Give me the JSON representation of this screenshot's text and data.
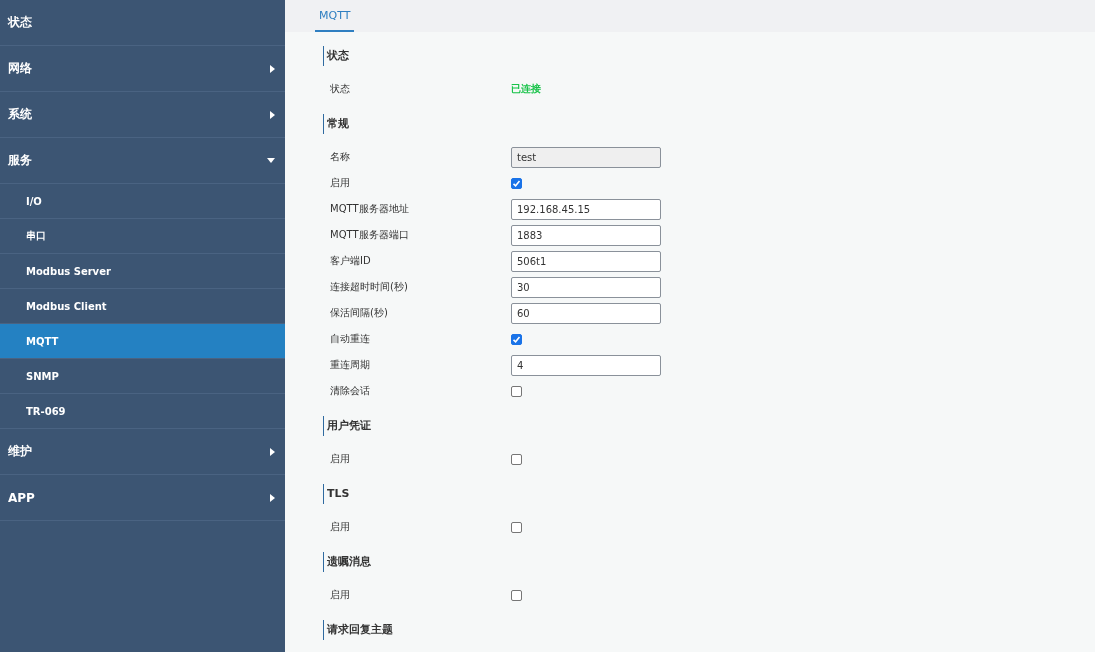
{
  "sidebar": {
    "items": [
      {
        "label": "状态"
      },
      {
        "label": "网络",
        "expanded": false
      },
      {
        "label": "系统",
        "expanded": false
      },
      {
        "label": "服务",
        "expanded": true,
        "children": [
          {
            "label": "I/O",
            "selected": false
          },
          {
            "label": "串口",
            "selected": false
          },
          {
            "label": "Modbus Server",
            "selected": false
          },
          {
            "label": "Modbus Client",
            "selected": false
          },
          {
            "label": "MQTT",
            "selected": true
          },
          {
            "label": "SNMP",
            "selected": false
          },
          {
            "label": "TR-069",
            "selected": false
          }
        ]
      },
      {
        "label": "维护",
        "expanded": false
      },
      {
        "label": "APP",
        "expanded": false
      }
    ]
  },
  "tabs": [
    {
      "label": "MQTT",
      "selected": true
    }
  ],
  "sections": [
    {
      "title": "状态",
      "rows": [
        {
          "kind": "status",
          "label": "状态",
          "value": "已连接"
        }
      ]
    },
    {
      "title": "常规",
      "rows": [
        {
          "kind": "input",
          "label": "名称",
          "value": "test",
          "disabled": true
        },
        {
          "kind": "checkbox",
          "label": "启用",
          "checked": true
        },
        {
          "kind": "input",
          "label": "MQTT服务器地址",
          "value": "192.168.45.15",
          "disabled": false
        },
        {
          "kind": "input",
          "label": "MQTT服务器端口",
          "value": "1883",
          "disabled": false
        },
        {
          "kind": "input",
          "label": "客户端ID",
          "value": "506t1",
          "disabled": false
        },
        {
          "kind": "input",
          "label": "连接超时时间(秒)",
          "value": "30",
          "disabled": false
        },
        {
          "kind": "input",
          "label": "保活间隔(秒)",
          "value": "60",
          "disabled": false
        },
        {
          "kind": "checkbox",
          "label": "自动重连",
          "checked": true
        },
        {
          "kind": "input",
          "label": "重连周期",
          "value": "4",
          "disabled": false
        },
        {
          "kind": "checkbox",
          "label": "清除会话",
          "checked": false
        }
      ]
    },
    {
      "title": "用户凭证",
      "rows": [
        {
          "kind": "checkbox",
          "label": "启用",
          "checked": false
        }
      ]
    },
    {
      "title": "TLS",
      "rows": [
        {
          "kind": "checkbox",
          "label": "启用",
          "checked": false
        }
      ]
    },
    {
      "title": "遗嘱消息",
      "rows": [
        {
          "kind": "checkbox",
          "label": "启用",
          "checked": false
        }
      ]
    },
    {
      "title": "请求回复主题"
    }
  ]
}
